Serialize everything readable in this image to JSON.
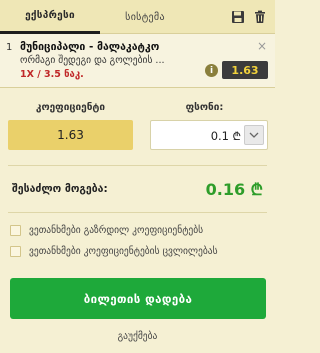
{
  "tabs": {
    "express": "ექსპრესი",
    "system": "სისტემა"
  },
  "bet": {
    "number": "1",
    "title": "მუნიციპალი - მალაკატკო",
    "market": "ორმაგი შედეგი და გოლების ...",
    "selection": "1X / 3.5 ნაკ.",
    "odds": "1.63",
    "close": "×",
    "info": "i"
  },
  "coeff": {
    "label": "კოეფიციენტი",
    "value": "1.63"
  },
  "stake": {
    "label": "ფსონი:",
    "value": "0.1",
    "currency": "₾"
  },
  "win": {
    "label": "შესაძლო მოგება:",
    "value": "0.16 ₾"
  },
  "options": [
    "ვეთანხმები გაზრდილ კოეფიციენტებს",
    "ვეთანხმები კოეფიციენტების ცვლილებას"
  ],
  "place_button": "ბილეთის დადება",
  "settings": "გაუქმება",
  "colors": {
    "accent_green": "#1ea93a",
    "odds_yellow": "#ead06a",
    "selection_red": "#c02828",
    "win_green": "#2e9d2a"
  },
  "icons": [
    "save-icon",
    "trash-icon",
    "close-icon",
    "info-icon",
    "chevron-down-icon",
    "checkbox-icon"
  ]
}
